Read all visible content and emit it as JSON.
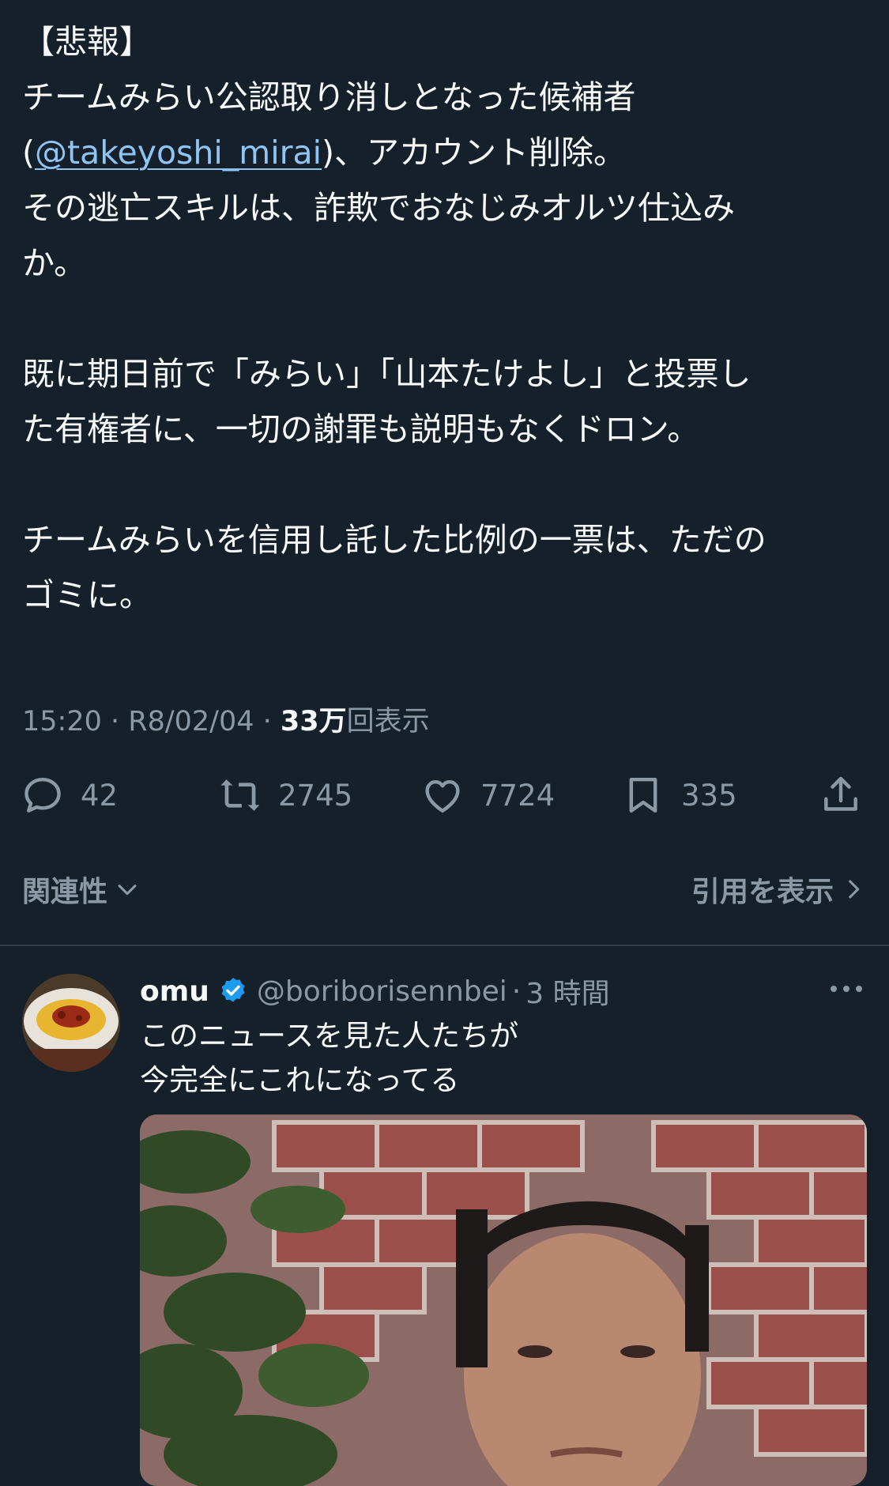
{
  "tweet": {
    "line1": "【悲報】",
    "line2": "チームみらい公認取り消しとなった候補者",
    "line3_open": "(",
    "mention": "@takeyoshi_mirai",
    "line3_close": ")、アカウント削除。",
    "line4": "その逃亡スキルは、詐欺でおなじみオルツ仕込み",
    "line5": "か。",
    "line6": "既に期日前で「みらい」「山本たけよし」と投票し",
    "line7": "た有権者に、一切の謝罪も説明もなくドロン。",
    "line8": "チームみらいを信用し託した比例の一票は、ただの",
    "line9": "ゴミに。"
  },
  "meta": {
    "time": "15:20",
    "sep1": " · ",
    "date": "R8/02/04",
    "sep2": " · ",
    "views_count": "33万",
    "views_label": "回表示"
  },
  "actions": {
    "reply_count": "42",
    "retweet_count": "2745",
    "like_count": "7724",
    "bookmark_count": "335"
  },
  "sort": {
    "relevance_label": "関連性",
    "quotes_label": "引用を表示"
  },
  "reply": {
    "name": "omu",
    "handle": "@boriborisennbei",
    "dot": "·",
    "time": "3 時間",
    "line1": "このニュースを見た人たちが",
    "line2": "今完全にこれになってる"
  },
  "colors": {
    "background": "#15202b",
    "text": "#f7f9f9",
    "secondary": "#8b98a5",
    "link": "#8ec5f5",
    "verified": "#1d9bf0"
  },
  "icons": [
    "reply-icon",
    "retweet-icon",
    "like-icon",
    "bookmark-icon",
    "share-icon",
    "chevron-down-icon",
    "chevron-right-icon",
    "verified-badge-icon",
    "more-icon"
  ]
}
